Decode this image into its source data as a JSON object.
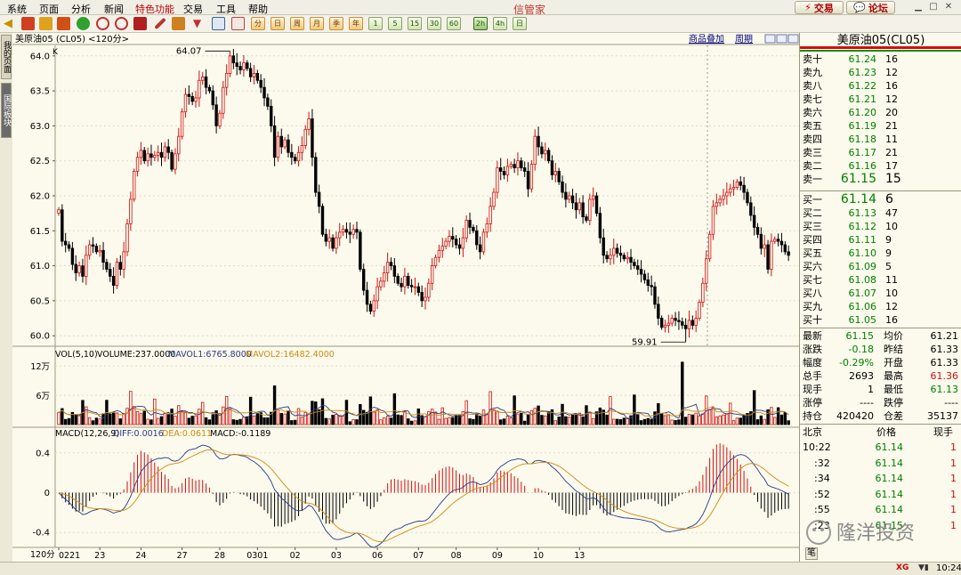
{
  "menu": {
    "items": [
      "系统",
      "页面",
      "分析",
      "新闻",
      "特色功能",
      "交易",
      "工具",
      "帮助"
    ],
    "active_index": 4,
    "app_title": "信管家",
    "trade_button": "交易",
    "forum_button": "论坛"
  },
  "toolbar": {
    "period_buttons": [
      "1",
      "5",
      "15",
      "30",
      "60",
      "2h",
      "4h",
      "日"
    ],
    "selected_period": "2h"
  },
  "side_tabs": [
    "我的页面",
    "国际板块"
  ],
  "chart_header": {
    "title": "美原油05 (CL05) <120分>",
    "overlay_link": "商品叠加",
    "period_link": "周期",
    "k_label": "K"
  },
  "volume_header": {
    "label": "VOL(5,10)",
    "volume": "VOLUME:237.0000",
    "mavol1": "MAVOL1:6765.8000",
    "mavol2": "MAVOL2:16482.4000",
    "ticks": [
      "12万",
      "6万"
    ]
  },
  "macd_header": {
    "label": "MACD(12,26,9)",
    "diff": "DIFF:0.0016",
    "dea": "DEA:0.0611",
    "macd": "MACD:-0.1189",
    "ticks": [
      "0.4",
      "0",
      "-0.4"
    ]
  },
  "chart_data": {
    "type": "candlestick",
    "instrument": "美原油05 (CL05)",
    "period": "120分",
    "price_axis": {
      "ticks": [
        60.0,
        60.5,
        61.0,
        61.5,
        62.0,
        62.5,
        63.0,
        63.5,
        64.0
      ],
      "ylim": [
        59.85,
        64.15
      ]
    },
    "high_annotation": "64.07",
    "low_annotation": "59.91",
    "x_tick_labels": [
      "0221",
      "23",
      "24",
      "27",
      "28",
      "0301",
      "02",
      "03",
      "06",
      "07",
      "08",
      "09",
      "10",
      "13"
    ],
    "x_tick_positions": [
      0,
      12,
      24,
      36,
      47,
      58,
      69,
      81,
      93,
      105,
      116,
      128,
      140,
      152
    ],
    "x_corner_label": "120分",
    "close": [
      61.8,
      61.35,
      61.3,
      61.25,
      61.02,
      60.9,
      61.0,
      60.85,
      61.15,
      61.3,
      61.28,
      61.2,
      61.22,
      61.05,
      60.95,
      60.85,
      60.72,
      61.05,
      60.95,
      61.2,
      61.6,
      61.95,
      62.35,
      62.55,
      62.65,
      62.5,
      62.6,
      62.55,
      62.58,
      62.62,
      62.55,
      62.7,
      62.62,
      62.38,
      62.6,
      62.85,
      63.2,
      63.45,
      63.42,
      63.35,
      63.4,
      63.65,
      63.7,
      63.55,
      63.5,
      63.3,
      63.0,
      63.18,
      63.55,
      63.75,
      64.0,
      63.9,
      63.85,
      63.8,
      63.9,
      63.82,
      63.7,
      63.75,
      63.65,
      63.55,
      63.4,
      63.28,
      63.0,
      62.55,
      62.85,
      62.7,
      62.8,
      62.62,
      62.55,
      62.5,
      62.62,
      62.72,
      62.95,
      63.1,
      62.55,
      62.05,
      61.85,
      61.45,
      61.35,
      61.4,
      61.25,
      61.4,
      61.48,
      61.52,
      61.48,
      61.45,
      61.52,
      61.48,
      60.95,
      60.65,
      60.45,
      60.35,
      60.5,
      60.7,
      60.78,
      60.9,
      61.05,
      61.0,
      60.85,
      60.75,
      60.7,
      60.85,
      60.72,
      60.7,
      60.7,
      60.62,
      60.5,
      60.55,
      60.75,
      61.0,
      61.12,
      61.22,
      61.28,
      61.35,
      61.42,
      61.38,
      61.3,
      61.25,
      61.4,
      61.65,
      61.55,
      61.5,
      61.3,
      61.2,
      61.48,
      61.6,
      61.85,
      62.05,
      62.4,
      62.35,
      62.3,
      62.42,
      62.45,
      62.4,
      62.5,
      62.4,
      62.35,
      62.1,
      62.45,
      62.85,
      62.7,
      62.6,
      62.65,
      62.5,
      62.3,
      62.35,
      62.2,
      62.05,
      61.95,
      62.0,
      61.9,
      61.8,
      61.9,
      61.7,
      61.65,
      61.95,
      62.0,
      61.75,
      61.4,
      61.15,
      61.1,
      61.15,
      61.25,
      61.18,
      61.15,
      61.1,
      61.12,
      61.05,
      61.0,
      60.95,
      60.88,
      60.8,
      60.72,
      60.7,
      60.45,
      60.25,
      60.12,
      60.15,
      60.18,
      60.25,
      60.22,
      60.2,
      60.15,
      60.1,
      60.22,
      60.15,
      60.25,
      60.48,
      60.75,
      61.1,
      61.45,
      61.85,
      61.9,
      61.95,
      62.0,
      62.05,
      62.1,
      62.12,
      62.2,
      62.15,
      62.05,
      61.9,
      61.72,
      61.55,
      61.45,
      61.25,
      61.3,
      60.95,
      61.35,
      61.38,
      61.35,
      61.3,
      61.2,
      61.15
    ],
    "volume_axis": {
      "ticks": [
        60000,
        120000
      ],
      "ymax": 135000
    },
    "macd_axis": {
      "ticks": [
        0.4,
        0,
        -0.4
      ],
      "ylim": [
        -0.55,
        0.55
      ]
    },
    "series": [
      {
        "name": "DIFF",
        "color": "#2a3a8a"
      },
      {
        "name": "DEA",
        "color": "#d08a10"
      },
      {
        "name": "MAVOL1",
        "color": "#2a3a8a"
      },
      {
        "name": "MAVOL2",
        "color": "#d08a10"
      }
    ],
    "colors": {
      "up": "#d01010",
      "down": "#000000",
      "background": "#fbfaec"
    }
  },
  "quote": {
    "title": "美原油05(CL05)",
    "asks": [
      {
        "label": "卖十",
        "price": "61.24",
        "qty": "16"
      },
      {
        "label": "卖九",
        "price": "61.23",
        "qty": "12"
      },
      {
        "label": "卖八",
        "price": "61.22",
        "qty": "16"
      },
      {
        "label": "卖七",
        "price": "61.21",
        "qty": "12"
      },
      {
        "label": "卖六",
        "price": "61.20",
        "qty": "20"
      },
      {
        "label": "卖五",
        "price": "61.19",
        "qty": "21"
      },
      {
        "label": "卖四",
        "price": "61.18",
        "qty": "11"
      },
      {
        "label": "卖三",
        "price": "61.17",
        "qty": "21"
      },
      {
        "label": "卖二",
        "price": "61.16",
        "qty": "17"
      },
      {
        "label": "卖一",
        "price": "61.15",
        "qty": "15"
      }
    ],
    "bids": [
      {
        "label": "买一",
        "price": "61.14",
        "qty": "6"
      },
      {
        "label": "买二",
        "price": "61.13",
        "qty": "47"
      },
      {
        "label": "买三",
        "price": "61.12",
        "qty": "10"
      },
      {
        "label": "买四",
        "price": "61.11",
        "qty": "9"
      },
      {
        "label": "买五",
        "price": "61.10",
        "qty": "9"
      },
      {
        "label": "买六",
        "price": "61.09",
        "qty": "5"
      },
      {
        "label": "买七",
        "price": "61.08",
        "qty": "11"
      },
      {
        "label": "买八",
        "price": "61.07",
        "qty": "10"
      },
      {
        "label": "买九",
        "price": "61.06",
        "qty": "12"
      },
      {
        "label": "买十",
        "price": "61.05",
        "qty": "16"
      }
    ],
    "stats": [
      {
        "l1": "最新",
        "v1": "61.15",
        "c1": "green",
        "l2": "均价",
        "v2": "61.21",
        "c2": "black"
      },
      {
        "l1": "涨跌",
        "v1": "-0.18",
        "c1": "green",
        "l2": "昨结",
        "v2": "61.33",
        "c2": "black"
      },
      {
        "l1": "幅度",
        "v1": "-0.29%",
        "c1": "green",
        "l2": "开盘",
        "v2": "61.33",
        "c2": "black"
      },
      {
        "l1": "总手",
        "v1": "2693",
        "c1": "black",
        "l2": "最高",
        "v2": "61.36",
        "c2": "red"
      },
      {
        "l1": "现手",
        "v1": "1",
        "c1": "black",
        "l2": "最低",
        "v2": "61.13",
        "c2": "green"
      },
      {
        "l1": "涨停",
        "v1": "----",
        "c1": "black",
        "l2": "跌停",
        "v2": "----",
        "c2": "black"
      },
      {
        "l1": "持仓",
        "v1": "420420",
        "c1": "black",
        "l2": "仓差",
        "v2": "35137",
        "c2": "black"
      }
    ],
    "ticks_header": {
      "c1": "北京",
      "c2": "价格",
      "c3": "现手"
    },
    "ticks": [
      {
        "time": "10:22",
        "price": "61.14",
        "qty": "1"
      },
      {
        "time": ":32",
        "price": "61.14",
        "qty": "1"
      },
      {
        "time": ":34",
        "price": "61.14",
        "qty": "1"
      },
      {
        "time": ":52",
        "price": "61.14",
        "qty": "1"
      },
      {
        "time": ":55",
        "price": "61.14",
        "qty": "1"
      },
      {
        "time": ":23",
        "price": "61.15",
        "qty": "1"
      }
    ],
    "footer_tab": "笔"
  },
  "watermark": "隆洋投资",
  "status": {
    "time": "10:24",
    "logo": "XG"
  }
}
